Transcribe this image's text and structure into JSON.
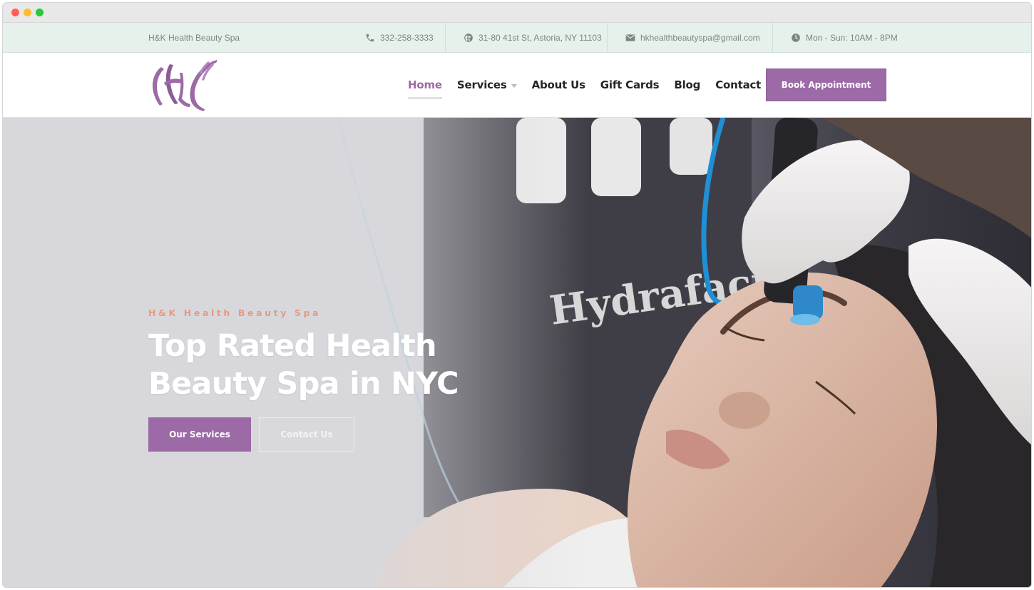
{
  "topbar": {
    "brand": "H&K Health Beauty Spa",
    "phone": "332-258-3333",
    "address": "31-80 41st St, Astoria, NY 11103",
    "email": "hkhealthbeautyspa@gmail.com",
    "hours": "Mon - Sun: 10AM - 8PM"
  },
  "nav": {
    "items": [
      {
        "label": "Home",
        "active": true
      },
      {
        "label": "Services",
        "has_dropdown": true
      },
      {
        "label": "About Us"
      },
      {
        "label": "Gift Cards"
      },
      {
        "label": "Blog"
      },
      {
        "label": "Contact"
      }
    ],
    "cta_label": "Book Appointment"
  },
  "hero": {
    "eyebrow": "H&K Health Beauty Spa",
    "title": "Top Rated Health Beauty Spa in NYC",
    "primary_button": "Our Services",
    "secondary_button": "Contact Us",
    "image_text": "Hydrafacial"
  },
  "colors": {
    "accent": "#9c6aa6",
    "topbar_bg": "#e7f1ec",
    "eyebrow": "#e59b7e"
  },
  "icons": [
    "phone-icon",
    "globe-icon",
    "envelope-icon",
    "clock-icon",
    "chevron-down-icon"
  ]
}
